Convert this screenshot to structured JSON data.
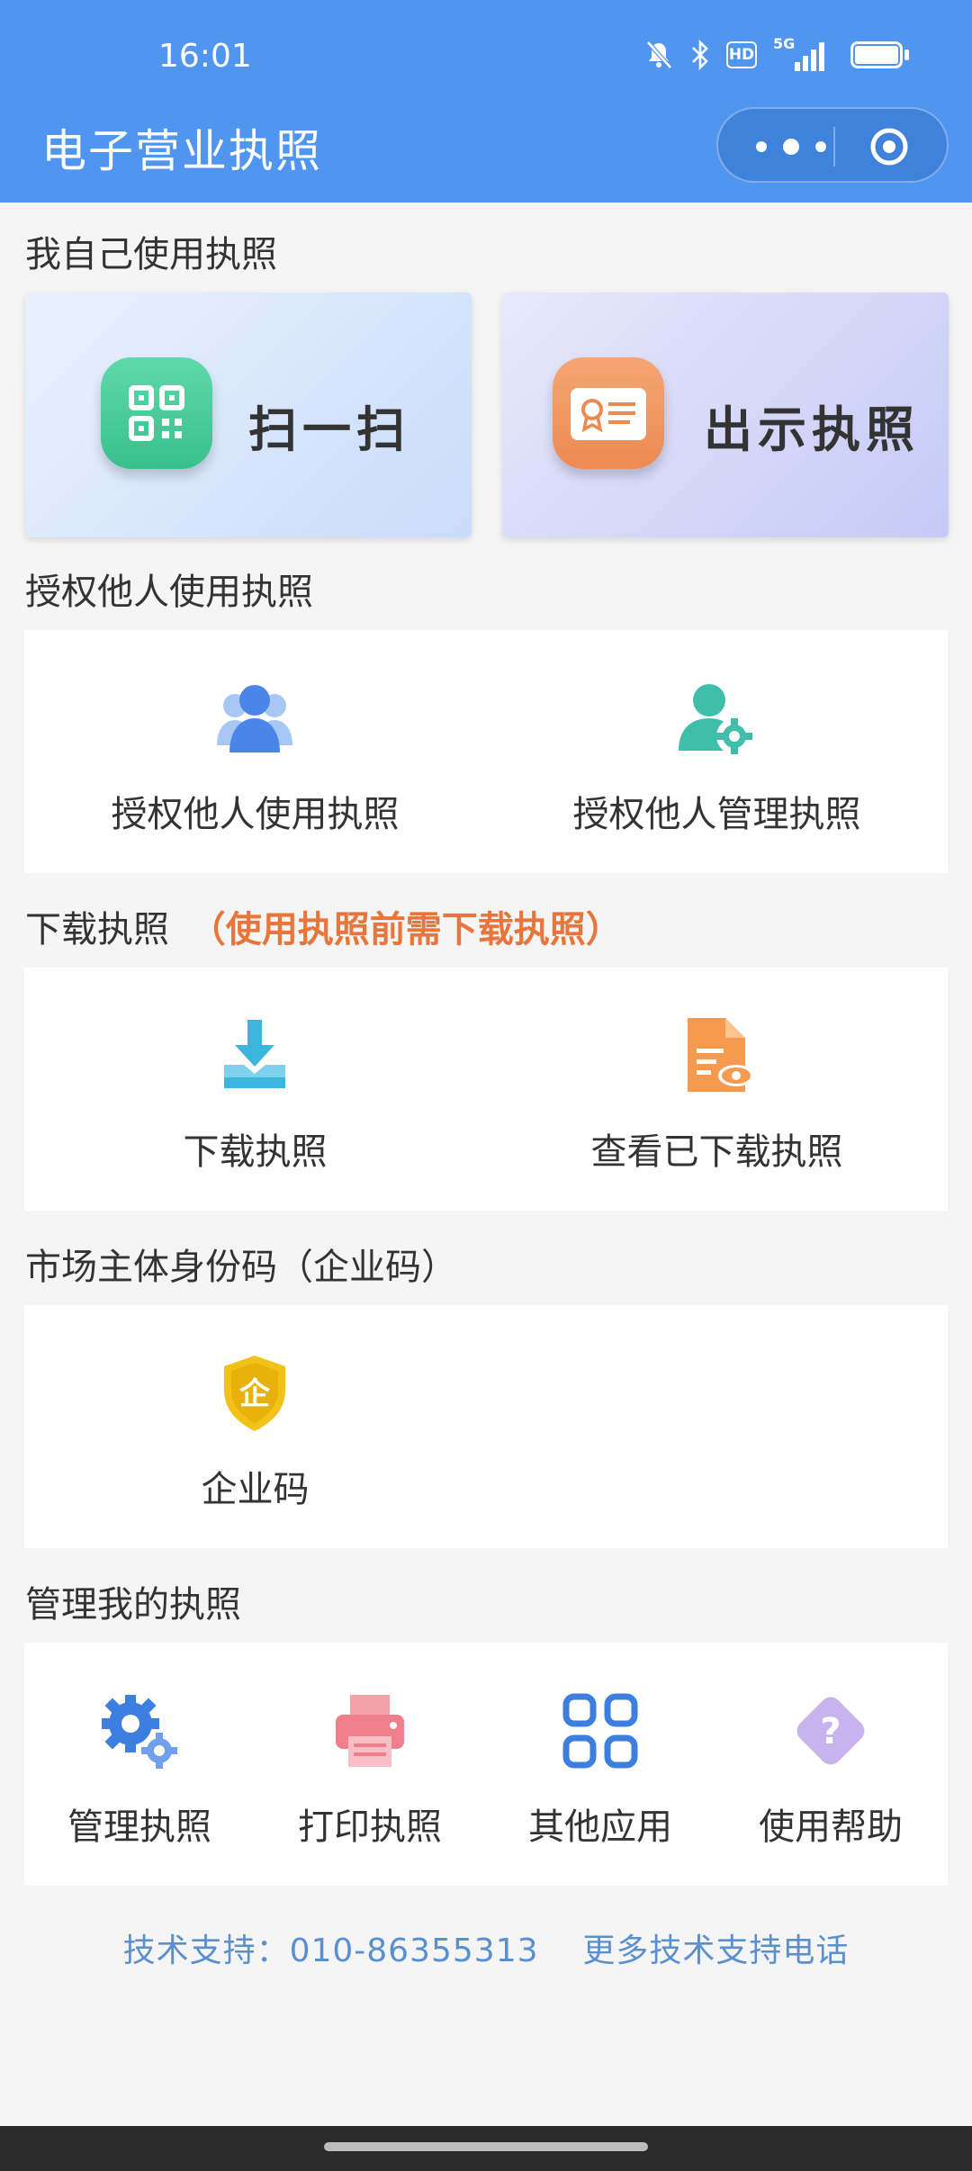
{
  "status_bar": {
    "time": "16:01",
    "icons": [
      "bell-off-icon",
      "bluetooth-icon",
      "hd-icon",
      "signal-5g-icon",
      "battery-icon"
    ],
    "hd_label": "HD",
    "network_label": "5G"
  },
  "header": {
    "title": "电子营业执照",
    "background": "#5096f0"
  },
  "section_self": {
    "title": "我自己使用执照",
    "cards": [
      {
        "label": "扫一扫",
        "icon": "qr-code-icon"
      },
      {
        "label": "出示执照",
        "icon": "license-card-icon"
      }
    ]
  },
  "section_authorize": {
    "title": "授权他人使用执照",
    "items": [
      {
        "label": "授权他人使用执照",
        "icon": "users-icon"
      },
      {
        "label": "授权他人管理执照",
        "icon": "user-settings-icon"
      }
    ]
  },
  "section_download": {
    "title": "下载执照",
    "note": "（使用执照前需下载执照）",
    "items": [
      {
        "label": "下载执照",
        "icon": "download-icon"
      },
      {
        "label": "查看已下载执照",
        "icon": "view-document-icon"
      }
    ]
  },
  "section_code": {
    "title": "市场主体身份码（企业码）",
    "items": [
      {
        "label": "企业码",
        "icon": "enterprise-shield-icon",
        "glyph": "企"
      }
    ]
  },
  "section_manage": {
    "title": "管理我的执照",
    "items": [
      {
        "label": "管理执照",
        "icon": "gear-icon"
      },
      {
        "label": "打印执照",
        "icon": "printer-icon"
      },
      {
        "label": "其他应用",
        "icon": "apps-grid-icon"
      },
      {
        "label": "使用帮助",
        "icon": "help-icon"
      }
    ]
  },
  "footer": {
    "support_label": "技术支持：",
    "support_phone": "010-86355313",
    "more_link": "更多技术支持电话"
  }
}
